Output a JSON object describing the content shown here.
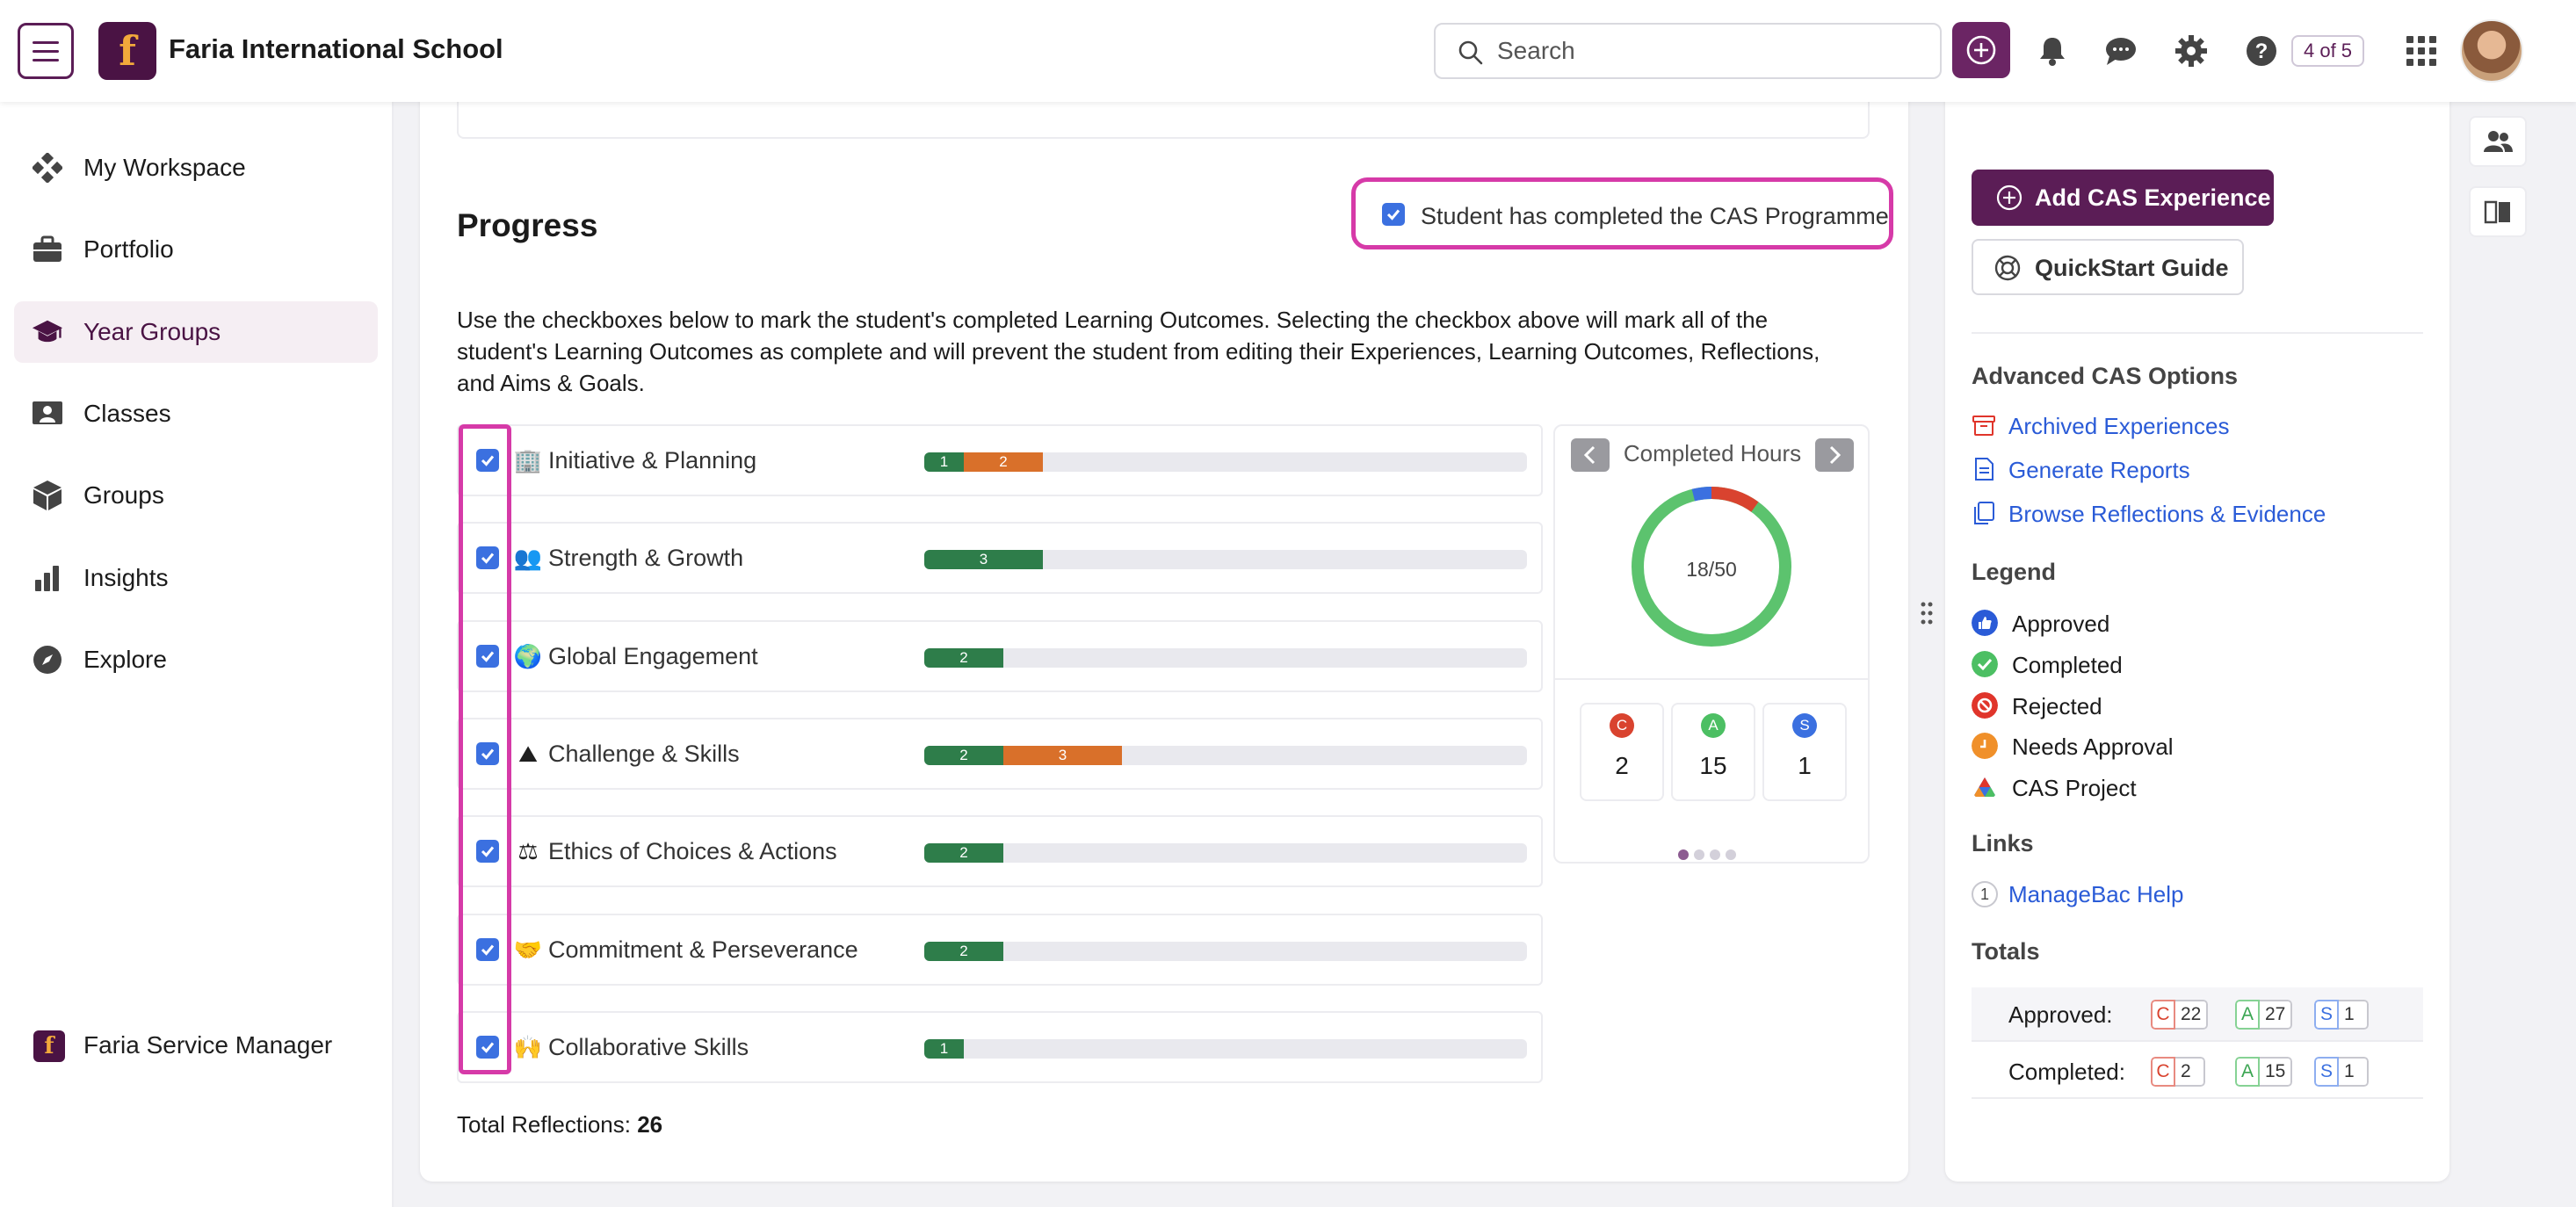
{
  "header": {
    "school_name": "Faria International School",
    "logo_letter": "f",
    "search_placeholder": "Search",
    "pager": "4 of 5"
  },
  "sidebar": {
    "items": [
      {
        "label": "My Workspace",
        "icon": "diamond-grid-icon"
      },
      {
        "label": "Portfolio",
        "icon": "briefcase-icon"
      },
      {
        "label": "Year Groups",
        "icon": "graduation-cap-icon",
        "active": true
      },
      {
        "label": "Classes",
        "icon": "classroom-icon"
      },
      {
        "label": "Groups",
        "icon": "cube-icon"
      },
      {
        "label": "Insights",
        "icon": "bar-chart-icon"
      },
      {
        "label": "Explore",
        "icon": "compass-icon"
      }
    ],
    "bottom_label": "Faria Service Manager"
  },
  "progress": {
    "title": "Progress",
    "cas_complete_label": "Student has completed the CAS Programme",
    "cas_complete_checked": true,
    "description": "Use the checkboxes below to mark the student's completed Learning Outcomes. Selecting the checkbox above will mark all of the student's Learning Outcomes as complete and will prevent the student from editing their Experiences, Learning Outcomes, Reflections, and Aims & Goals.",
    "outcomes": [
      {
        "label": "Initiative & Planning",
        "emoji": "🏢",
        "checked": true,
        "segments": [
          {
            "value": "1",
            "color": "green"
          },
          {
            "value": "2",
            "color": "orange"
          }
        ]
      },
      {
        "label": "Strength & Growth",
        "emoji": "👥",
        "checked": true,
        "segments": [
          {
            "value": "3",
            "color": "green"
          }
        ]
      },
      {
        "label": "Global Engagement",
        "emoji": "🌍",
        "checked": true,
        "segments": [
          {
            "value": "2",
            "color": "green"
          }
        ]
      },
      {
        "label": "Challenge & Skills",
        "emoji": "⛰",
        "checked": true,
        "segments": [
          {
            "value": "2",
            "color": "green"
          },
          {
            "value": "3",
            "color": "orange"
          }
        ]
      },
      {
        "label": "Ethics of Choices & Actions",
        "emoji": "⚖",
        "checked": true,
        "segments": [
          {
            "value": "2",
            "color": "green"
          }
        ]
      },
      {
        "label": "Commitment & Perseverance",
        "emoji": "🤝",
        "checked": true,
        "segments": [
          {
            "value": "2",
            "color": "green"
          }
        ]
      },
      {
        "label": "Collaborative Skills",
        "emoji": "🙌",
        "checked": true,
        "segments": [
          {
            "value": "1",
            "color": "green"
          }
        ]
      }
    ],
    "total_reflections_label": "Total Reflections:",
    "total_reflections_value": "26"
  },
  "hours": {
    "title": "Completed Hours",
    "donut_label": "18/50",
    "donut": {
      "green": 0.86,
      "red": 0.1,
      "blue": 0.04
    },
    "stats": [
      {
        "letter": "C",
        "value": "2",
        "color": "#d9432f"
      },
      {
        "letter": "A",
        "value": "15",
        "color": "#4cbf63"
      },
      {
        "letter": "S",
        "value": "1",
        "color": "#3b70e0"
      }
    ],
    "page_indicator_count": 4,
    "page_indicator_active": 0
  },
  "details": {
    "add_button": "Add CAS Experience",
    "quickstart_button": "QuickStart Guide",
    "advanced_heading": "Advanced CAS Options",
    "advanced_links": [
      "Archived Experiences",
      "Generate Reports",
      "Browse Reflections & Evidence"
    ],
    "legend_heading": "Legend",
    "legend": [
      {
        "label": "Approved",
        "icon": "thumbs-up-icon",
        "color": "#2a5bd7"
      },
      {
        "label": "Completed",
        "icon": "check-circle-icon",
        "color": "#4cbf63"
      },
      {
        "label": "Rejected",
        "icon": "ban-icon",
        "color": "#e0352b"
      },
      {
        "label": "Needs Approval",
        "icon": "clock-icon",
        "color": "#f0902a"
      },
      {
        "label": "CAS Project",
        "icon": "triangle-icon",
        "color": "#e0352b"
      }
    ],
    "links_heading": "Links",
    "links_count": "1",
    "help_link": "ManageBac Help",
    "totals_heading": "Totals",
    "totals": [
      {
        "label": "Approved:",
        "c": "22",
        "a": "27",
        "s": "1"
      },
      {
        "label": "Completed:",
        "c": "2",
        "a": "15",
        "s": "1"
      }
    ]
  }
}
